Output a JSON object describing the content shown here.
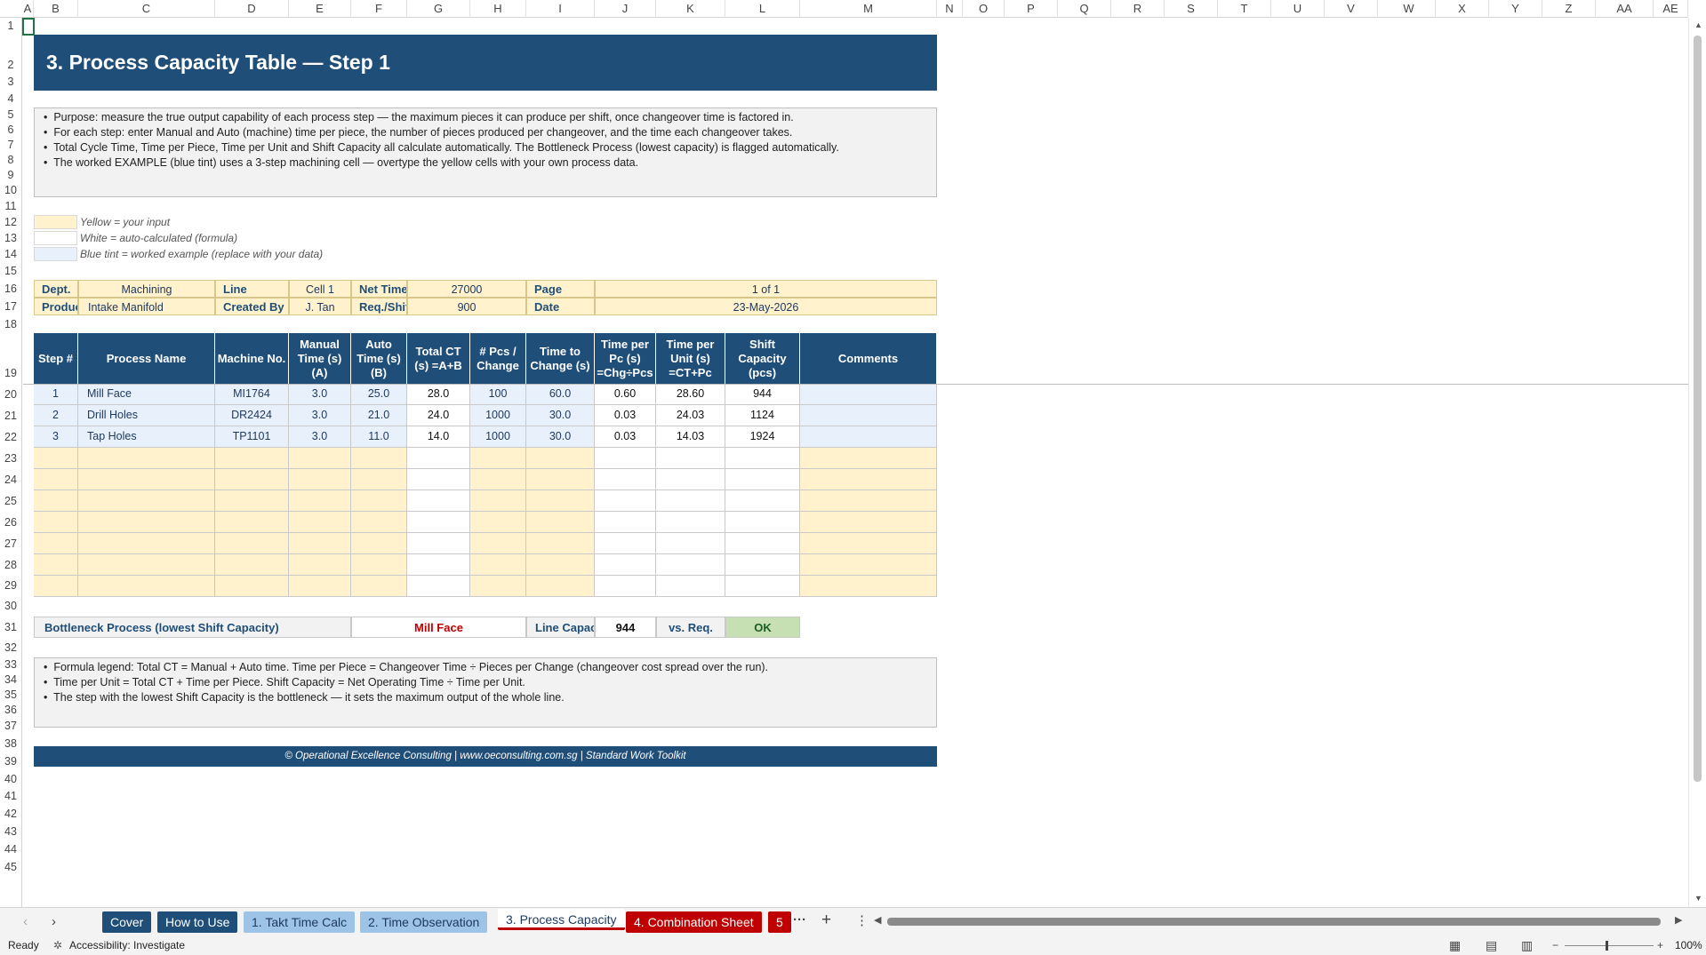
{
  "columns": [
    "A",
    "B",
    "C",
    "D",
    "E",
    "F",
    "G",
    "H",
    "I",
    "J",
    "K",
    "L",
    "M",
    "N",
    "O",
    "P",
    "Q",
    "R",
    "S",
    "T",
    "U",
    "V",
    "W",
    "X",
    "Y",
    "Z",
    "AA",
    "AE"
  ],
  "rows": [
    "1",
    "2",
    "3",
    "4",
    "5",
    "6",
    "7",
    "8",
    "9",
    "10",
    "11",
    "12",
    "13",
    "14",
    "15",
    "16",
    "17",
    "18",
    "19",
    "20",
    "21",
    "22",
    "23",
    "24",
    "25",
    "26",
    "27",
    "28",
    "29",
    "30",
    "31",
    "32",
    "33",
    "34",
    "35",
    "36",
    "37",
    "38",
    "39",
    "40",
    "41",
    "42",
    "43",
    "44",
    "45"
  ],
  "title": "3. Process Capacity Table  —  Step 1",
  "purpose_notes": [
    "Purpose: measure the true output capability of each process step — the maximum pieces it can produce per shift, once changeover time is factored in.",
    "For each step: enter Manual and Auto (machine) time per piece, the number of pieces produced per changeover, and the time each changeover takes.",
    "Total Cycle Time, Time per Piece, Time per Unit and Shift Capacity all calculate automatically. The Bottleneck Process (lowest capacity) is flagged automatically.",
    "The worked EXAMPLE (blue tint) uses a 3-step machining cell — overtype the yellow cells with your own process data."
  ],
  "legend": {
    "yellow": "Yellow = your input",
    "white": "White = auto-calculated (formula)",
    "blue": "Blue tint = worked example (replace with your data)"
  },
  "info": {
    "dept_label": "Dept.",
    "dept": "Machining",
    "line_label": "Line",
    "line": "Cell 1",
    "net_label": "Net Time",
    "net": "27000",
    "page_label": "Page",
    "page": "1 of 1",
    "prod_label": "Product",
    "prod": "Intake Manifold",
    "created_label": "Created By",
    "created": "J. Tan",
    "req_label": "Req./Shift",
    "req": "900",
    "date_label": "Date",
    "date": "23-May-2026"
  },
  "table_headers": [
    "Step #",
    "Process Name",
    "Machine No.",
    "Manual Time (s) (A)",
    "Auto Time (s) (B)",
    "Total CT (s) =A+B",
    "# Pcs / Change",
    "Time to Change (s)",
    "Time per Pc (s) =Chg÷Pcs",
    "Time per Unit (s) =CT+Pc",
    "Shift Capacity (pcs)",
    "Comments"
  ],
  "table_rows": [
    [
      "1",
      "Mill Face",
      "MI1764",
      "3.0",
      "25.0",
      "28.0",
      "100",
      "60.0",
      "0.60",
      "28.60",
      "944",
      ""
    ],
    [
      "2",
      "Drill Holes",
      "DR2424",
      "3.0",
      "21.0",
      "24.0",
      "1000",
      "30.0",
      "0.03",
      "24.03",
      "1124",
      ""
    ],
    [
      "3",
      "Tap Holes",
      "TP1101",
      "3.0",
      "11.0",
      "14.0",
      "1000",
      "30.0",
      "0.03",
      "14.03",
      "1924",
      ""
    ]
  ],
  "bottleneck": {
    "label": "Bottleneck Process (lowest Shift Capacity)",
    "process": "Mill Face",
    "cap_label": "Line Capacity",
    "cap": "944",
    "vs_label": "vs. Req.",
    "status": "OK"
  },
  "formula_notes": [
    "Formula legend:  Total CT = Manual + Auto time.   Time per Piece = Changeover Time ÷ Pieces per Change (changeover cost spread over the run).",
    "Time per Unit = Total CT + Time per Piece.   Shift Capacity = Net Operating Time ÷ Time per Unit.",
    "The step with the lowest Shift Capacity is the bottleneck — it sets the maximum output of the whole line."
  ],
  "footer": "© Operational Excellence Consulting  |  www.oeconsulting.com.sg  |  Standard Work Toolkit",
  "tabs": [
    {
      "label": "Cover",
      "bg": "#1f4e79",
      "fg": "#ffffff"
    },
    {
      "label": "How to Use",
      "bg": "#1f4e79",
      "fg": "#ffffff"
    },
    {
      "label": "1. Takt Time Calc",
      "bg": "#9dc3e6",
      "fg": "#1f3a60"
    },
    {
      "label": "2. Time Observation",
      "bg": "#9dc3e6",
      "fg": "#1f3a60"
    },
    {
      "label": "3. Process Capacity",
      "bg": "#ffffff",
      "fg": "#1f3a60"
    },
    {
      "label": "4. Combination Sheet",
      "bg": "#c00000",
      "fg": "#ffffff"
    },
    {
      "label": "5",
      "bg": "#c00000",
      "fg": "#ffffff"
    }
  ],
  "status": {
    "ready": "Ready",
    "accessibility": "Accessibility: Investigate",
    "zoom": "100%"
  }
}
